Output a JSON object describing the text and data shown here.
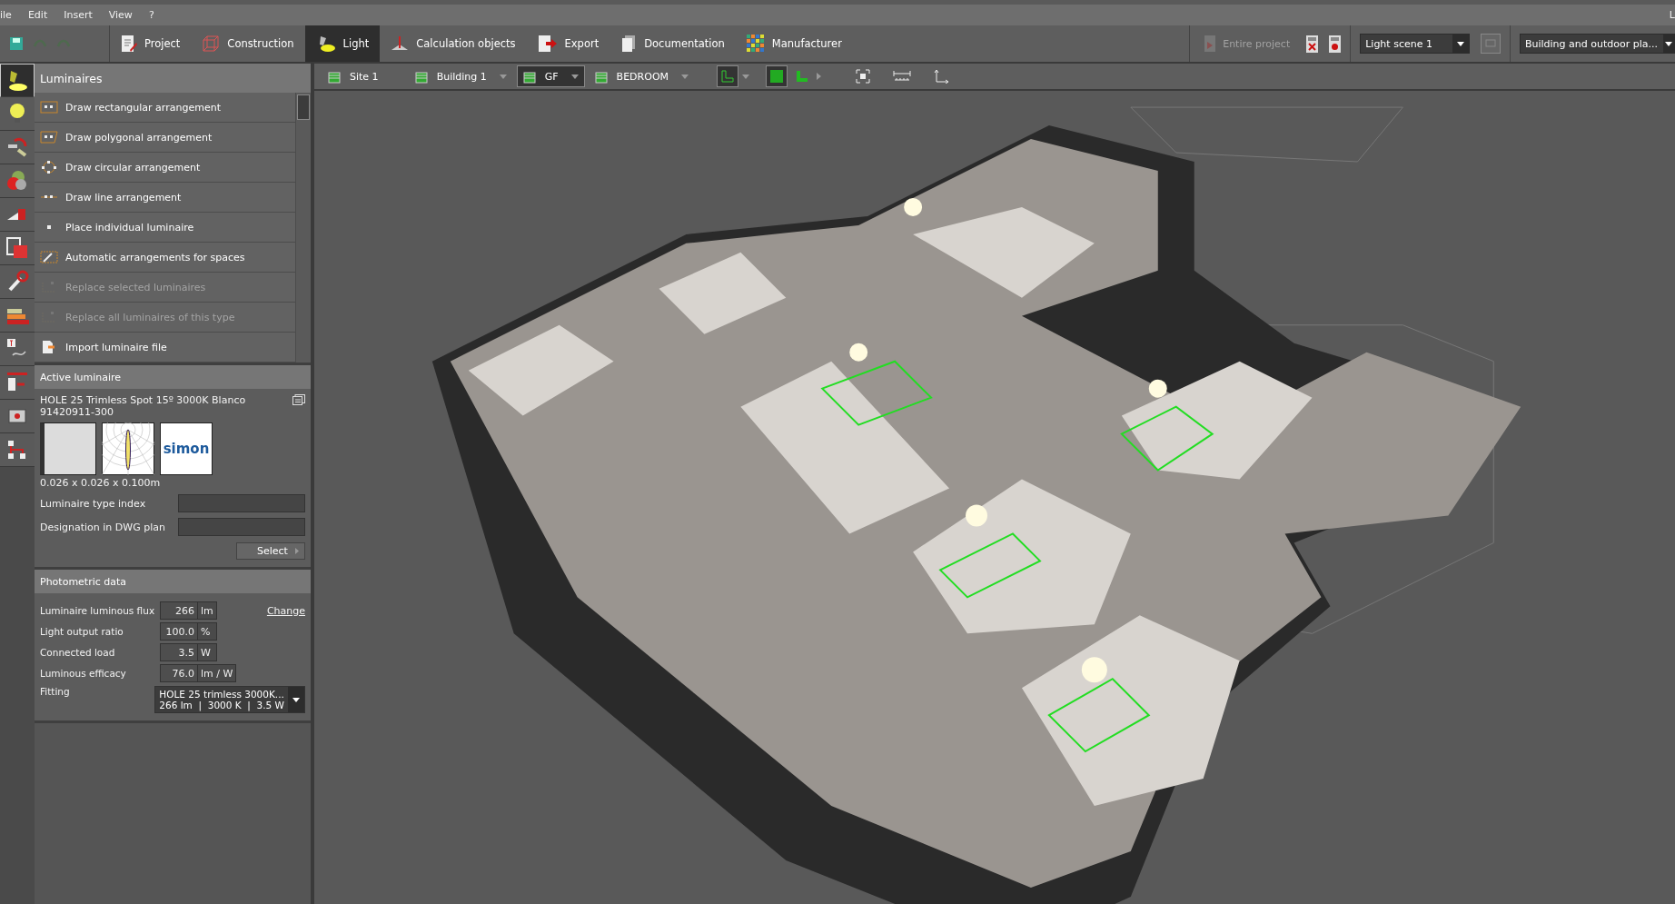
{
  "menu": [
    {
      "label": "ile"
    },
    {
      "label": "Edit"
    },
    {
      "label": "Insert"
    },
    {
      "label": "View"
    },
    {
      "label": "?"
    }
  ],
  "menu_corner": "L",
  "tabs": [
    {
      "label": "Project",
      "selected": false,
      "kind": "project"
    },
    {
      "label": "Construction",
      "selected": false,
      "kind": "construction"
    },
    {
      "label": "Light",
      "selected": true,
      "kind": "light"
    },
    {
      "label": "Calculation objects",
      "selected": false,
      "kind": "calc"
    },
    {
      "label": "Export",
      "selected": false,
      "kind": "export"
    },
    {
      "label": "Documentation",
      "selected": false,
      "kind": "docs"
    },
    {
      "label": "Manufacturer",
      "selected": false,
      "kind": "manufacturer"
    }
  ],
  "calc_button": {
    "label": "Entire project",
    "disabled": true
  },
  "light_scene": "Light scene 1",
  "view_select": "Building and outdoor pla...",
  "breadcrumb": [
    {
      "label": "Site 1",
      "dropdown": false,
      "selected": false
    },
    {
      "label": "Building 1",
      "dropdown": true,
      "selected": false
    },
    {
      "label": "GF",
      "dropdown": true,
      "selected": true
    },
    {
      "label": "BEDROOM",
      "dropdown": true,
      "selected": false
    }
  ],
  "rail": [
    {
      "kind": "luminaire",
      "selected": true
    },
    {
      "kind": "bulb",
      "selected": false
    },
    {
      "kind": "tools",
      "selected": false
    },
    {
      "kind": "colors",
      "selected": false
    },
    {
      "kind": "ramp",
      "selected": false
    },
    {
      "kind": "square",
      "selected": false
    },
    {
      "kind": "wrench",
      "selected": false
    },
    {
      "kind": "stack",
      "selected": false
    },
    {
      "kind": "text",
      "selected": false
    },
    {
      "kind": "wall",
      "selected": false
    },
    {
      "kind": "frame",
      "selected": false
    },
    {
      "kind": "tree",
      "selected": false
    }
  ],
  "luminaires": {
    "title": "Luminaires",
    "items": [
      {
        "label": "Draw rectangular arrangement",
        "kind": "rect",
        "disabled": false
      },
      {
        "label": "Draw polygonal arrangement",
        "kind": "poly",
        "disabled": false
      },
      {
        "label": "Draw circular arrangement",
        "kind": "circle",
        "disabled": false
      },
      {
        "label": "Draw line arrangement",
        "kind": "line",
        "disabled": false
      },
      {
        "label": "Place individual luminaire",
        "kind": "single",
        "disabled": false
      },
      {
        "label": "Automatic arrangements for spaces",
        "kind": "auto",
        "disabled": false
      },
      {
        "label": "Replace selected luminaires",
        "kind": "replace",
        "disabled": true
      },
      {
        "label": "Replace all luminaires of this type",
        "kind": "replace",
        "disabled": true
      },
      {
        "label": "Import luminaire file",
        "kind": "import",
        "disabled": false
      }
    ]
  },
  "active_luminaire": {
    "title": "Active luminaire",
    "name": "HOLE 25 Trimless Spot 15º 3000K Blanco",
    "code": "91420911-300",
    "logo": "simon",
    "dimensions": "0.026 x 0.026 x 0.100m",
    "fields": [
      {
        "label": "Luminaire type index"
      },
      {
        "label": "Designation in DWG plan"
      }
    ],
    "select_button": "Select"
  },
  "photometric": {
    "title": "Photometric data",
    "change_link": "Change",
    "rows": [
      {
        "label": "Luminaire luminous flux",
        "value": "266",
        "unit": "lm"
      },
      {
        "label": "Light output ratio",
        "value": "100.0",
        "unit": "%"
      },
      {
        "label": "Connected load",
        "value": "3.5",
        "unit": "W"
      },
      {
        "label": "Luminous efficacy",
        "value": "76.0",
        "unit": "lm / W"
      }
    ],
    "fitting": {
      "label": "Fitting",
      "line_1": "HOLE 25 trimless 3000K...",
      "line_2": "266 lm  |  3000 K  |  3.5 W"
    }
  }
}
